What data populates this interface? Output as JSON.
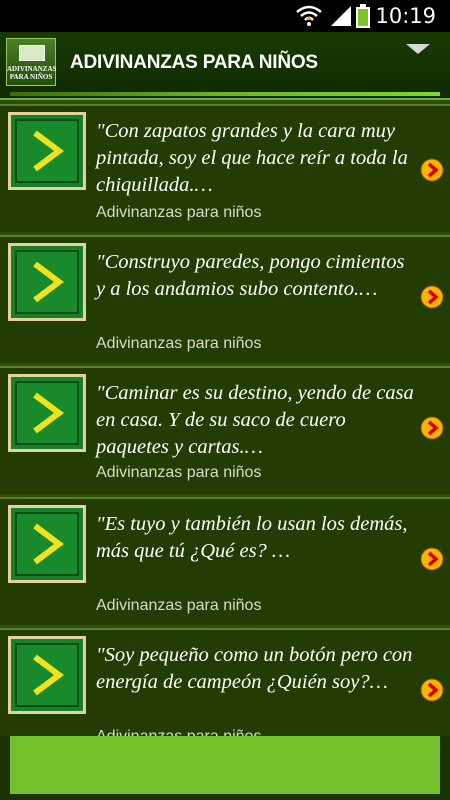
{
  "status_bar": {
    "time": "10:19",
    "icons": [
      "wifi-icon",
      "signal-icon",
      "battery-icon"
    ]
  },
  "header": {
    "logo_text": "ADIVINANZAS PARA NIÑOS",
    "title": "ADIVINANZAS PARA NIÑOS",
    "menu_icon": "menu-triangle-icon"
  },
  "colors": {
    "background": "#2f4e05",
    "header": "#183a02",
    "accent": "#74c12c",
    "arrow": "#ff9900"
  },
  "items": [
    {
      "riddle": "\"Con zapatos grandes y la cara muy pintada, soy el que hace reír a toda la chiquillada.…",
      "source": "Adivinanzas para niños"
    },
    {
      "riddle": "\"Construyo paredes, pongo cimientos y a los andamios subo contento.…",
      "source": "Adivinanzas para niños"
    },
    {
      "riddle": "\"Caminar es su destino, yendo de casa en casa. Y de su saco de cuero paquetes y cartas.…",
      "source": "Adivinanzas para niños"
    },
    {
      "riddle": "\"Es tuyo y también lo usan los demás, más que tú ¿Qué es? …",
      "source": "Adivinanzas para niños"
    },
    {
      "riddle": "\"Soy pequeño como un botón pero con energía de campeón ¿Quién soy?…",
      "source": "Adivinanzas para niños"
    }
  ]
}
